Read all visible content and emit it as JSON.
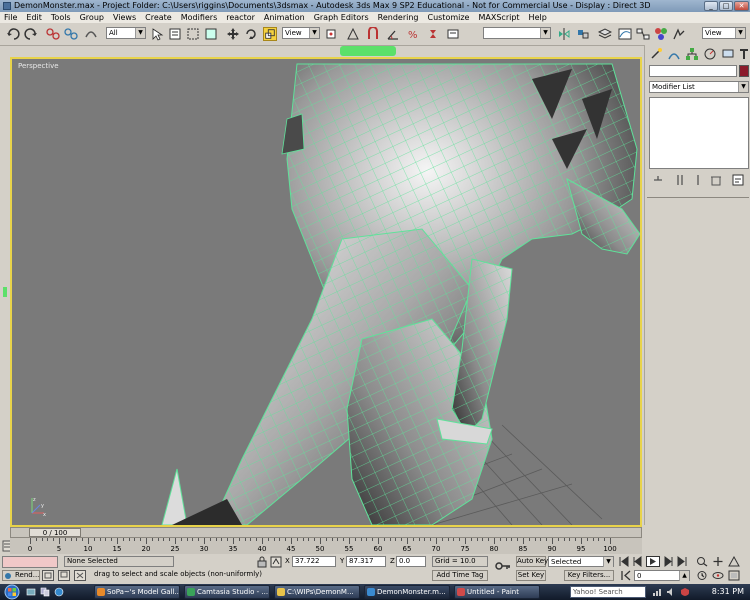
{
  "window": {
    "title": "DemonMonster.max    - Project Folder: C:\\Users\\riggins\\Documents\\3dsmax    - Autodesk 3ds Max 9 SP2  Educational - Not for Commercial Use    - Display : Direct 3D",
    "minimize": "_",
    "maximize": "□",
    "close": "✕"
  },
  "menu": [
    "File",
    "Edit",
    "Tools",
    "Group",
    "Views",
    "Create",
    "Modifiers",
    "reactor",
    "Animation",
    "Graph Editors",
    "Rendering",
    "Customize",
    "MAXScript",
    "Help"
  ],
  "toolbar": {
    "selection_filter": "All",
    "ref_coord": "View",
    "named_sel": "",
    "view_right": "View"
  },
  "viewport": {
    "label": "Perspective",
    "selection_tab": "",
    "colors": {
      "wire": "#5fe29a",
      "mesh_light": "#e6e6e6",
      "mesh_dark": "#4a4a4a",
      "bg": "#7a7a7a",
      "active_border": "#e8d34a"
    }
  },
  "command_panel": {
    "name_color": "#8b1a2a",
    "modifier_list": "Modifier List"
  },
  "timeline": {
    "slider_label": "0 / 100",
    "ticks": [
      "0",
      "5",
      "10",
      "15",
      "20",
      "25",
      "30",
      "35",
      "40",
      "45",
      "50",
      "55",
      "60",
      "65",
      "70",
      "75",
      "80",
      "85",
      "90",
      "95",
      "100"
    ]
  },
  "status": {
    "selection": "None Selected",
    "prompt": "drag to select and scale objects (non-uniformly)",
    "x_label": "X",
    "x_value": "37.722",
    "y_label": "Y",
    "y_value": "87.317",
    "z_label": "Z",
    "z_value": "0.0",
    "grid": "Grid = 10.0",
    "add_time_tag": "Add Time Tag",
    "auto_key": "Auto Key",
    "set_key": "Set Key",
    "key_mode": "Selected",
    "key_filters": "Key Filters...",
    "frame": "0",
    "render_btn": "Rend..."
  },
  "taskbar": {
    "tasks": [
      {
        "label": "SoPa~'s Model Gall...",
        "color": "#e88a2a"
      },
      {
        "label": "Camtasia Studio - ...",
        "color": "#3aa35a"
      },
      {
        "label": "C:\\WIPs\\DemonM...",
        "color": "#e8c34a"
      },
      {
        "label": "DemonMonster.m...",
        "color": "#3a8ad0"
      },
      {
        "label": "Untitled - Paint",
        "color": "#d04a4a"
      }
    ],
    "search": "Yahoo! Search",
    "clock": "8:31 PM"
  }
}
